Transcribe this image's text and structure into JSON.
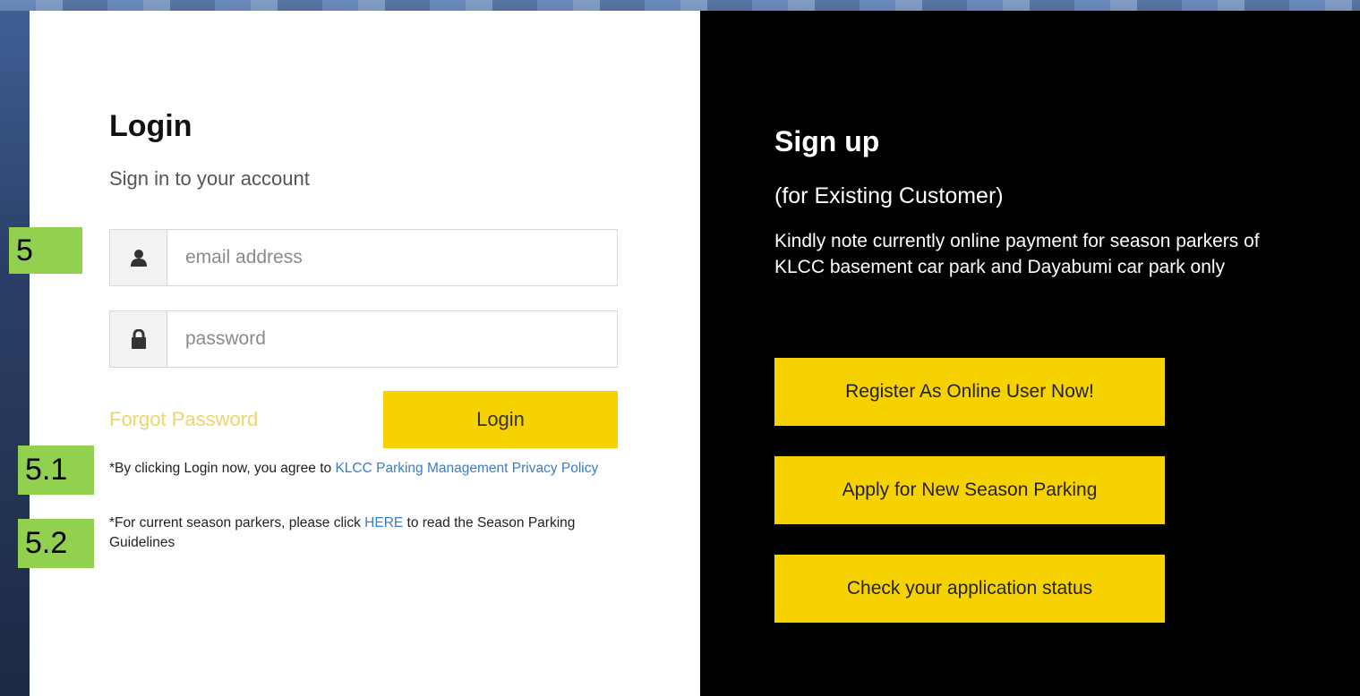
{
  "login": {
    "title": "Login",
    "subtitle": "Sign in to your account",
    "email_placeholder": "email address",
    "password_placeholder": "password",
    "forgot_label": "Forgot Password",
    "login_label": "Login",
    "agree_prefix": "*By clicking Login now, you agree to ",
    "privacy_link": "KLCC Parking Management Privacy Policy",
    "season_prefix": "*For current season parkers, please click ",
    "here_link": "HERE",
    "season_suffix": " to read the Season Parking Guidelines",
    "icons": {
      "user": "user-icon",
      "lock": "lock-icon"
    }
  },
  "badges": {
    "b5": "5",
    "b51": "5.1",
    "b52": "5.2",
    "color": "#92d050"
  },
  "signup": {
    "title": "Sign up",
    "subtitle": "(for Existing Customer)",
    "note": "Kindly note currently online payment for season parkers of KLCC basement car park and Dayabumi car park only",
    "buttons": [
      {
        "label": "Register As Online User Now!"
      },
      {
        "label": "Apply for New Season Parking"
      },
      {
        "label": "Check your application status"
      }
    ]
  },
  "colors": {
    "accent": "#f5d200",
    "link": "#3a7cc9",
    "forgot": "#f0d468"
  }
}
